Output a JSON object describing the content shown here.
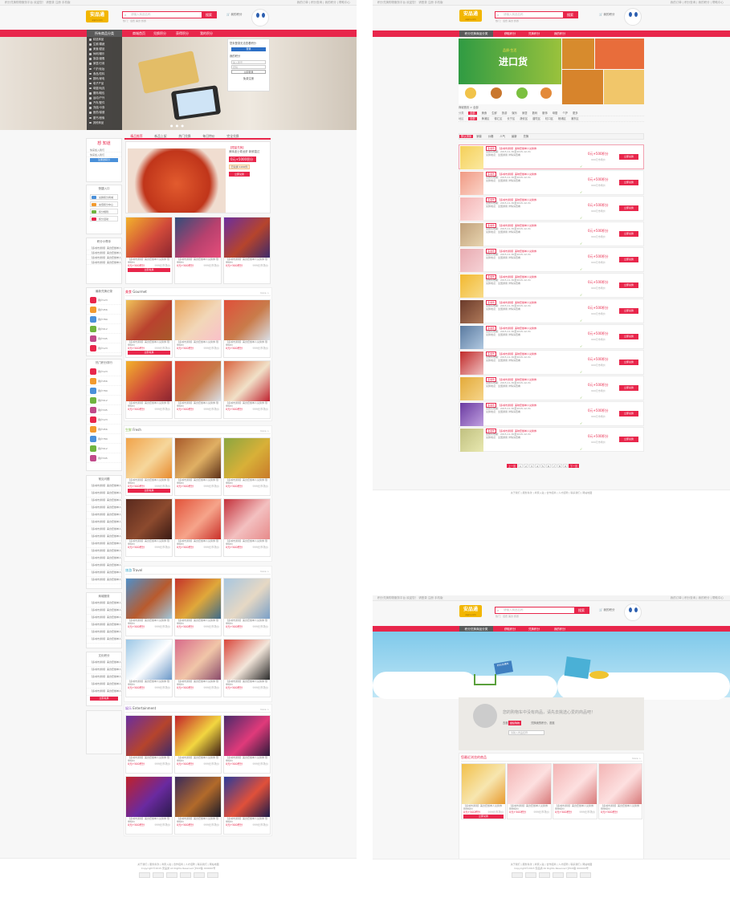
{
  "site": {
    "logo_text": "安品通",
    "logo_sub": "anpin.com",
    "search_placeholder": "请输入商品名称",
    "search_button": "搜索",
    "cart_label": "我的积分",
    "hot_keywords": "热门：话费 美食 旅游"
  },
  "topbar": {
    "left": "积分兑换购物服务平台 欢迎您！ 请登录 注册 手机版",
    "right": "我的订单 | 积分查询 | 我的积分 | 帮助中心"
  },
  "panelA": {
    "nav": [
      "所有商品分类",
      "商城首页",
      "兑换积分",
      "获得积分",
      "我的积分"
    ],
    "categories": [
      "精选商品",
      "生鲜/果蔬",
      "美食/甜品",
      "休闲/娱乐",
      "旅游/度假",
      "家居/日用",
      "个护/化妆",
      "食品/饮料",
      "数码/家电",
      "电子产品",
      "母婴/玩具",
      "服饰/鞋包",
      "运动/户外",
      "汽车/配件",
      "充值/卡券",
      "医药/保健",
      "图书/音像",
      "其他商品"
    ],
    "login": {
      "title": "您未登录无法查看积分",
      "btn": "登录",
      "hint": "我的积分",
      "label": "输入账号",
      "pass": "密码",
      "login_btn": "立即登录",
      "join": "免费注册"
    },
    "hero_dots": "● ● ●",
    "tabs": [
      "精品推荐",
      "新品上架",
      "热门兑换",
      "每日特价",
      "完全兑换"
    ],
    "feature": {
      "title": "【限量兑换】",
      "desc": "美味波士顿龙虾 新鲜直达",
      "price": "0元+5000积分",
      "note": "已兑换 1200件",
      "btn": "立即兑换"
    },
    "sidebar": {
      "want": "想 知道",
      "want2": "快来加入我们",
      "join": "注册送积分",
      "q_title": "快捷入口",
      "q_items": [
        "兑换积分商城",
        "充值积分中心",
        "积分规则",
        "积分活动"
      ],
      "help": "积分小帮手",
      "tops": "最新兑换记录",
      "users": [
        "用户123",
        "用户456",
        "用户789",
        "用户012",
        "用户345"
      ],
      "ranks": "热门积分排行",
      "faq": "常见问题",
      "sc": "文化积分",
      "svc": "商城服务"
    },
    "sections": [
      {
        "name": "美食",
        "en": "Gourmet"
      },
      {
        "name": "生鲜",
        "en": "Fresh"
      },
      {
        "name": "旅游",
        "en": "Travel"
      },
      {
        "name": "娱乐",
        "en": "Entertainment"
      }
    ],
    "more": "more >",
    "price": "0元+500积分",
    "orig": "999元市场价",
    "buy": "立即兑换",
    "caption": "【多城市通用】美食套餐单人兑换券 限量特价"
  },
  "panelB": {
    "nav": [
      "积分兑换商品分类",
      "获取积分",
      "兑换积分",
      "我的积分"
    ],
    "banner_text": "进口货",
    "banner_sub": "品质·生活",
    "breadcrumb": "商城首页 > 全部",
    "filters": [
      {
        "k": "分类",
        "v": [
          "全部",
          "美食",
          "生鲜",
          "旅游",
          "娱乐",
          "家居",
          "数码",
          "服饰",
          "母婴",
          "个护",
          "更多"
        ]
      },
      {
        "k": "地区",
        "v": [
          "全部",
          "黄浦区",
          "徐汇区",
          "长宁区",
          "静安区",
          "普陀区",
          "虹口区",
          "杨浦区",
          "浦东区"
        ]
      }
    ],
    "sort": [
      "默认排序",
      "销量",
      "价格",
      "人气",
      "最新",
      "兑换"
    ],
    "item_title": "【多城市通用】美味套餐单人兑换券",
    "item_tag": "多城市",
    "item_line2": "兑换有效期：2015-11-30至2015-12-31",
    "item_line3": "兑换地点：全国通用 详情请查看",
    "item_price": "0元+500积分",
    "item_orig": "999元市场价",
    "item_btn": "立即兑换",
    "pager": [
      "上一页",
      "1",
      "2",
      "3",
      "4",
      "5",
      "6",
      "7",
      "8",
      "9",
      "下一页"
    ]
  },
  "panelC": {
    "nav": [
      "积分兑换商品分类",
      "获取积分",
      "兑换积分",
      "我的积分"
    ],
    "cart_msg": "您的购物车中没有商品，请先去挑选心爱的商品吧！",
    "b1": "去逛逛",
    "b2": "继续购物",
    "b3": "兑换我的积分，逛逛",
    "cart_input": "请输入商品名称",
    "recent": "您最近浏览的商品",
    "price": "0元+500积分",
    "orig": "999元市场价",
    "buy": "立即兑换",
    "shelf": "积分兑换车"
  },
  "footer": {
    "links": "关于我们 | 服务条款 | 商家入驻 | 合作招商 | 人才招聘 | 联系我们 | 网站地图",
    "copy": "Copyright©2015 安品通 All Rights Reserved 沪ICP备 000000号"
  },
  "colors": {
    "brand": "#e8264b",
    "accent": "#f2b600"
  }
}
